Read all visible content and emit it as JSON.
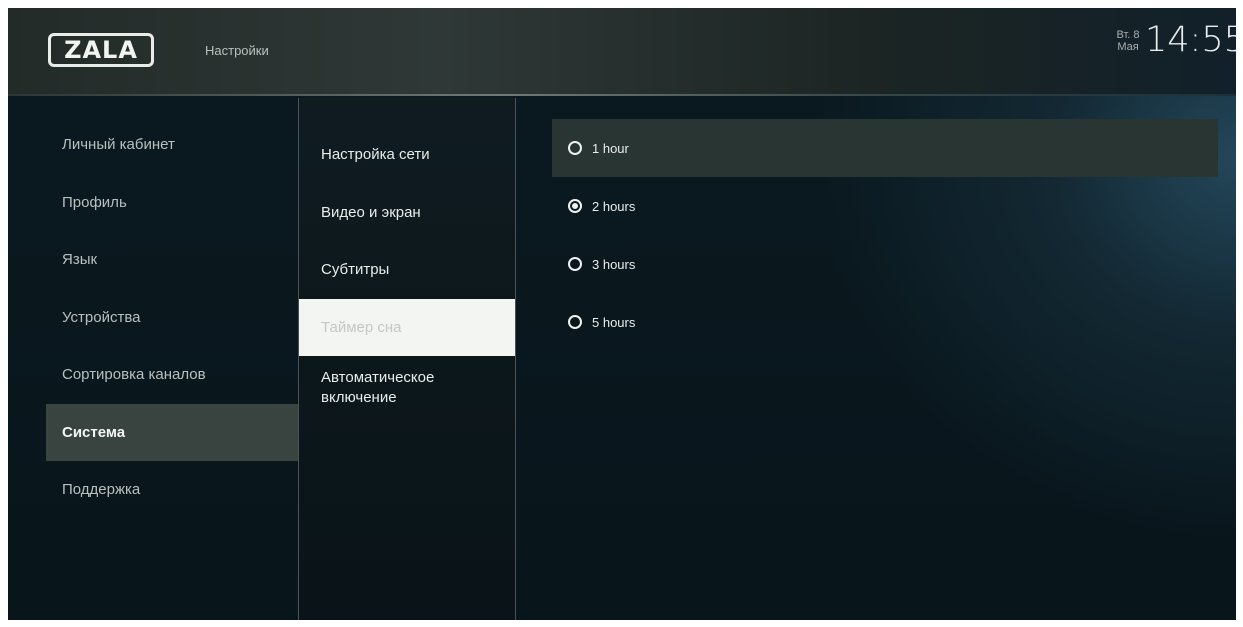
{
  "header": {
    "logo_text": "ZALA",
    "title": "Настройки",
    "date_day": "Вт. 8",
    "date_month": "Мая",
    "time": "14:55"
  },
  "menu": {
    "items": [
      {
        "label": "Личный кабинет"
      },
      {
        "label": "Профиль"
      },
      {
        "label": "Язык"
      },
      {
        "label": "Устройства"
      },
      {
        "label": "Сортировка каналов"
      },
      {
        "label": "Система"
      },
      {
        "label": "Поддержка"
      }
    ],
    "active_index": 5
  },
  "submenu": {
    "items": [
      {
        "label": "Настройка сети"
      },
      {
        "label": "Видео и экран"
      },
      {
        "label": "Субтитры"
      },
      {
        "label": "Таймер сна"
      },
      {
        "label": "Автоматическое включение"
      }
    ],
    "selected_index": 3
  },
  "options": {
    "items": [
      {
        "label": "1 hour",
        "checked": false
      },
      {
        "label": "2 hours",
        "checked": true
      },
      {
        "label": "3 hours",
        "checked": false
      },
      {
        "label": "5 hours",
        "checked": false
      }
    ],
    "focused_index": 0
  }
}
